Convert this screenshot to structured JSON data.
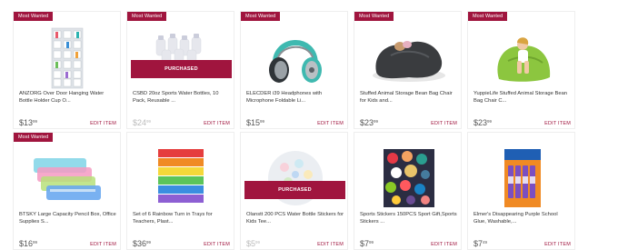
{
  "badge_label": "Most Wanted",
  "purchased_label": "PURCHASED",
  "edit_label": "EDIT ITEM",
  "colors": {
    "accent": "#a0153e"
  },
  "items": [
    {
      "title": "ANZORG Over Door Hanging Water Bottle Holder Cup O...",
      "price_dollars": "$13",
      "price_cents": "99",
      "most_wanted": true,
      "purchased": false,
      "image": "hanging-organizer-image"
    },
    {
      "title": "CSBD 20oz Sports Water Bottles, 10 Pack, Reusable ...",
      "price_dollars": "$24",
      "price_cents": "99",
      "most_wanted": true,
      "purchased": true,
      "image": "water-bottles-image"
    },
    {
      "title": "ELECDER i39 Headphones with Microphone Foldable Li...",
      "price_dollars": "$15",
      "price_cents": "99",
      "most_wanted": true,
      "purchased": false,
      "image": "headphones-image"
    },
    {
      "title": "Stuffed Animal Storage Bean Bag Chair for Kids and...",
      "price_dollars": "$23",
      "price_cents": "99",
      "most_wanted": true,
      "purchased": false,
      "image": "bean-bag-image"
    },
    {
      "title": "YuppieLife Stuffed Animal Storage Bean Bag Chair C...",
      "price_dollars": "$23",
      "price_cents": "99",
      "most_wanted": true,
      "purchased": false,
      "image": "kid-bean-bag-image"
    },
    {
      "title": "BTSKY Large Capacity Pencil Box, Office Supplies S...",
      "price_dollars": "$16",
      "price_cents": "99",
      "most_wanted": true,
      "purchased": false,
      "image": "pencil-box-image"
    },
    {
      "title": "Set of 6 Rainbow Turn in Trays for Teachers, Plast...",
      "price_dollars": "$36",
      "price_cents": "99",
      "most_wanted": false,
      "purchased": false,
      "image": "rainbow-trays-image"
    },
    {
      "title": "Olanstt 200 PCS Water Bottle Stickers for Kids Tee...",
      "price_dollars": "$5",
      "price_cents": "99",
      "most_wanted": false,
      "purchased": true,
      "image": "sticker-pile-image"
    },
    {
      "title": "Sports Stickers 150PCS Sport Gift,Sports Stickers ...",
      "price_dollars": "$7",
      "price_cents": "99",
      "most_wanted": false,
      "purchased": false,
      "image": "sports-stickers-image"
    },
    {
      "title": "Elmer's Disappearing Purple School Glue, Washable,...",
      "price_dollars": "$7",
      "price_cents": "49",
      "most_wanted": false,
      "purchased": false,
      "image": "glue-sticks-image"
    }
  ]
}
